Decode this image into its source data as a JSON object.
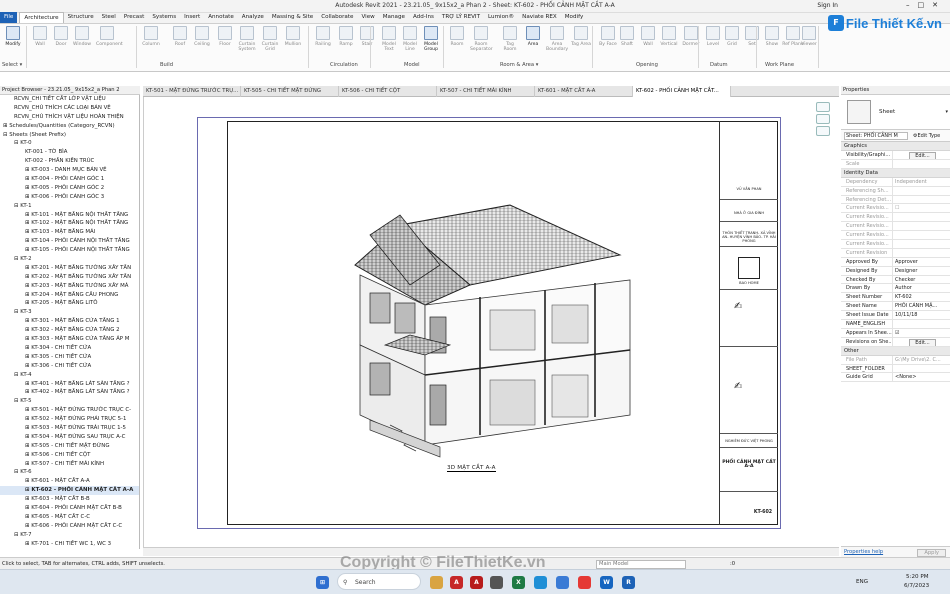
{
  "app": {
    "title": "Autodesk Revit 2021 - 23.21.05_ 9x15x2_a Phan 2 - Sheet: KT-602 - PHỐI CẢNH MẶT CẮT A-A",
    "sign_in": "Sign In"
  },
  "ribbon": {
    "tabs": [
      "File",
      "Architecture",
      "Structure",
      "Steel",
      "Precast",
      "Systems",
      "Insert",
      "Annotate",
      "Analyze",
      "Massing & Site",
      "Collaborate",
      "View",
      "Manage",
      "Add-Ins",
      "TRỢ LÝ REVIT",
      "Lumion®",
      "Naviate REX",
      "Modify"
    ],
    "active_tab": "Architecture",
    "buttons": [
      "Modify",
      "Wall",
      "Door",
      "Window",
      "Component",
      "Column",
      "Roof",
      "Ceiling",
      "Floor",
      "Curtain System",
      "Curtain Grid",
      "Mullion",
      "Railing",
      "Ramp",
      "Stair",
      "Model Text",
      "Model Line",
      "Model Group",
      "Room",
      "Room Separator",
      "Tag Room",
      "Area",
      "Area Boundary",
      "Tag Area",
      "By Face",
      "Shaft",
      "Wall",
      "Vertical",
      "Dormer",
      "Level",
      "Grid",
      "Set",
      "Show",
      "Ref Plane",
      "Viewer"
    ],
    "panels": [
      "Select ▾",
      "Build",
      "Circulation",
      "Model",
      "Room & Area ▾",
      "Opening",
      "Datum",
      "Work Plane"
    ]
  },
  "logo": {
    "mark": "F",
    "text": "File Thiết Kế.vn"
  },
  "project_browser": {
    "title": "Project Browser - 23.21.05_ 9x15x2_a Phan 2",
    "items": [
      {
        "label": "RCVN_CHI TIẾT CẮT LỚP VẬT LIỆU",
        "level": 1
      },
      {
        "label": "RCVN_CHÚ THÍCH CÁC LOẠI BẢN VẼ",
        "level": 1
      },
      {
        "label": "RCVN_CHÚ THÍCH VẬT LIỆU HOÀN THIỆN",
        "level": 1
      },
      {
        "label": "⊞ Schedules/Quantities (Category_RCVN)",
        "level": 0
      },
      {
        "label": "⊟ Sheets (Sheet Prefix)",
        "level": 0
      },
      {
        "label": "⊟ KT-0",
        "level": 1
      },
      {
        "label": "KT-001 - TỜ BÌA",
        "level": 2
      },
      {
        "label": "KT-002 - PHẦN KIẾN TRÚC",
        "level": 2
      },
      {
        "label": "⊞ KT-003 - DANH MỤC BẢN VẼ",
        "level": 2
      },
      {
        "label": "⊞ KT-004 - PHỐI CẢNH GÓC 1",
        "level": 2
      },
      {
        "label": "⊞ KT-005 - PHỐI CẢNH GÓC 2",
        "level": 2
      },
      {
        "label": "⊞ KT-006 - PHỐI CẢNH GÓC 3",
        "level": 2
      },
      {
        "label": "⊟ KT-1",
        "level": 1
      },
      {
        "label": "⊞ KT-101 - MẶT BẰNG NỘI THẤT TẦNG",
        "level": 2
      },
      {
        "label": "⊞ KT-102 - MẶT BẰNG NỘI THẤT TẦNG",
        "level": 2
      },
      {
        "label": "⊞ KT-103 - MẶT BẰNG MÁI",
        "level": 2
      },
      {
        "label": "⊞ KT-104 - PHỐI CẢNH NỘI THẤT TẦNG",
        "level": 2
      },
      {
        "label": "⊞ KT-105 - PHỐI CẢNH NỘI THẤT TẦNG",
        "level": 2
      },
      {
        "label": "⊟ KT-2",
        "level": 1
      },
      {
        "label": "⊞ KT-201 - MẶT BẰNG TƯỜNG XÂY TẦN",
        "level": 2
      },
      {
        "label": "⊞ KT-202 - MẶT BẰNG TƯỜNG XÂY TẦN",
        "level": 2
      },
      {
        "label": "⊞ KT-203 - MẶT BẰNG TƯỜNG XÂY MÁ",
        "level": 2
      },
      {
        "label": "⊞ KT-204 - MẶT BẰNG CẦU PHONG",
        "level": 2
      },
      {
        "label": "⊞ KT-205 - MẶT BẰNG LITÔ",
        "level": 2
      },
      {
        "label": "⊟ KT-3",
        "level": 1
      },
      {
        "label": "⊞ KT-301 - MẶT BẰNG CỬA TẦNG 1",
        "level": 2
      },
      {
        "label": "⊞ KT-302 - MẶT BẰNG CỬA TẦNG 2",
        "level": 2
      },
      {
        "label": "⊞ KT-303 - MẶT BẰNG CỬA TẦNG ÁP M",
        "level": 2
      },
      {
        "label": "⊞ KT-304 - CHI TIẾT CỬA",
        "level": 2
      },
      {
        "label": "⊞ KT-305 - CHI TIẾT CỬA",
        "level": 2
      },
      {
        "label": "⊞ KT-306 - CHI TIẾT CỬA",
        "level": 2
      },
      {
        "label": "⊟ KT-4",
        "level": 1
      },
      {
        "label": "⊞ KT-401 - MẶT BẰNG LÁT SÀN TẦNG ?",
        "level": 2
      },
      {
        "label": "⊞ KT-402 - MẶT BẰNG LÁT SÀN TẦNG ?",
        "level": 2
      },
      {
        "label": "⊟ KT-5",
        "level": 1
      },
      {
        "label": "⊞ KT-501 - MẶT ĐỨNG TRƯỚC TRỤC C-",
        "level": 2
      },
      {
        "label": "⊞ KT-502 - MẶT ĐỨNG PHẢI TRỤC 5-1",
        "level": 2
      },
      {
        "label": "⊞ KT-503 - MẶT ĐỨNG TRÁI TRỤC 1-5",
        "level": 2
      },
      {
        "label": "⊞ KT-504 - MẶT ĐỨNG SAU TRỤC A-C",
        "level": 2
      },
      {
        "label": "⊞ KT-505 - CHI TIẾT MẶT ĐỨNG",
        "level": 2
      },
      {
        "label": "⊞ KT-506 - CHI TIẾT CỘT",
        "level": 2
      },
      {
        "label": "⊞ KT-507 - CHI TIẾT MÁI KÍNH",
        "level": 2
      },
      {
        "label": "⊟ KT-6",
        "level": 1
      },
      {
        "label": "⊞ KT-601 - MẶT CẮT A-A",
        "level": 2
      },
      {
        "label": "⊞ KT-602 - PHỐI CẢNH MẶT CẮT A-A",
        "level": 2,
        "selected": true
      },
      {
        "label": "⊞ KT-603 - MẶT CẮT B-B",
        "level": 2
      },
      {
        "label": "⊞ KT-604 - PHỐI CẢNH MẶT CẮT B-B",
        "level": 2
      },
      {
        "label": "⊞ KT-605 - MẶT CẮT C-C",
        "level": 2
      },
      {
        "label": "⊞ KT-606 - PHỐI CẢNH MẶT CẮT C-C",
        "level": 2
      },
      {
        "label": "⊟ KT-7",
        "level": 1
      },
      {
        "label": "⊞ KT-701 - CHI TIẾT WC 1, WC 3",
        "level": 2
      }
    ]
  },
  "view_tabs": [
    {
      "label": "KT-501 - MẶT ĐỨNG TRƯỚC TRỤ...",
      "active": false
    },
    {
      "label": "KT-505 - CHI TIẾT MẶT ĐỨNG",
      "active": false
    },
    {
      "label": "KT-506 - CHI TIẾT CỘT",
      "active": false
    },
    {
      "label": "KT-507 - CHI TIẾT MÁI KÍNH",
      "active": false
    },
    {
      "label": "KT-601 - MẶT CẮT A-A",
      "active": false
    },
    {
      "label": "KT-602 - PHỐI CẢNH MẶT CẮT...",
      "active": true
    }
  ],
  "sheet": {
    "view_caption": "3D MẶT CẮT A-A",
    "titleblock": {
      "designer": "VŨ VĂN PHAN",
      "project": "NHÀ Ở GIA ĐÌNH",
      "address": "THÔN THIẾT TRANH- XÃ VĨNH AN- HUYỆN VĨNH BẢO- TP. HẢI PHÒNG",
      "company": "BAO HOME",
      "checker": "NGHIÊM ĐỨC VIỆT PHONG",
      "sheet_title": "PHỐI CẢNH MẶT CẮT A-A",
      "sheet_number": "KT-602"
    }
  },
  "properties": {
    "title": "Properties",
    "type_name": "Sheet",
    "selector": "Sheet: PHỐI CẢNH M",
    "edit_type": "Edit Type",
    "groups": [
      {
        "name": "Graphics",
        "rows": [
          {
            "k": "Visibility/Graphi...",
            "v": "Edit...",
            "btn": true
          },
          {
            "k": "Scale",
            "v": "",
            "dim": true
          }
        ]
      },
      {
        "name": "Identity Data",
        "rows": [
          {
            "k": "Dependency",
            "v": "Independent",
            "dim": true
          },
          {
            "k": "Referencing Sh...",
            "v": "",
            "dim": true
          },
          {
            "k": "Referencing Det...",
            "v": "",
            "dim": true
          },
          {
            "k": "Current Revisio...",
            "v": "☐",
            "dim": true
          },
          {
            "k": "Current Revisio...",
            "v": "",
            "dim": true
          },
          {
            "k": "Current Revisio...",
            "v": "",
            "dim": true
          },
          {
            "k": "Current Revisio...",
            "v": "",
            "dim": true
          },
          {
            "k": "Current Revisio...",
            "v": "",
            "dim": true
          },
          {
            "k": "Current Revision",
            "v": "",
            "dim": true
          },
          {
            "k": "Approved By",
            "v": "Approver"
          },
          {
            "k": "Designed By",
            "v": "Designer"
          },
          {
            "k": "Checked By",
            "v": "Checker"
          },
          {
            "k": "Drawn By",
            "v": "Author"
          },
          {
            "k": "Sheet Number",
            "v": "KT-602"
          },
          {
            "k": "Sheet Name",
            "v": "PHỐI CẢNH MẶ..."
          },
          {
            "k": "Sheet Issue Date",
            "v": "10/11/18"
          },
          {
            "k": "NAME_ENGLISH",
            "v": ""
          },
          {
            "k": "Appears In Shee...",
            "v": "☑"
          },
          {
            "k": "Revisions on She...",
            "v": "Edit...",
            "btn": true
          }
        ]
      },
      {
        "name": "Other",
        "rows": [
          {
            "k": "File Path",
            "v": "G:\\My Drive\\2. C...",
            "dim": true
          },
          {
            "k": "SHEET_FOLDER",
            "v": ""
          },
          {
            "k": "Guide Grid",
            "v": "<None>"
          }
        ]
      }
    ],
    "help": "Properties help",
    "apply": "Apply"
  },
  "status": {
    "hint": "Click to select, TAB for alternates, CTRL adds, SHIFT unselects.",
    "model": "Main Model",
    "scale_val": ":0"
  },
  "watermark": "Copyright © FileThietKe.vn",
  "taskbar": {
    "search_placeholder": "Search",
    "lang": "ENG",
    "time": "5:20 PM",
    "date": "6/7/2023"
  }
}
